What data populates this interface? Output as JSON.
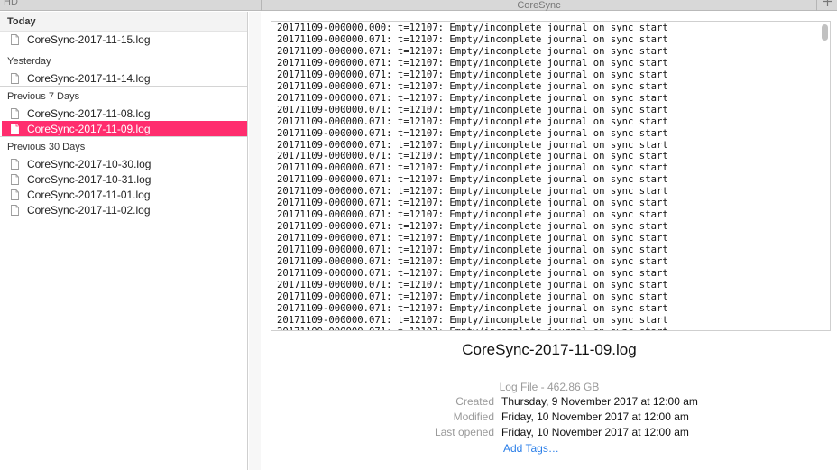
{
  "tabbar": {
    "left_label": "HD",
    "title": "CoreSync"
  },
  "sidebar": {
    "sections": [
      {
        "header": "Today",
        "files": [
          "CoreSync-2017-11-15.log"
        ]
      },
      {
        "header": "Yesterday",
        "files": [
          "CoreSync-2017-11-14.log"
        ]
      },
      {
        "header": "Previous 7 Days",
        "files": [
          "CoreSync-2017-11-08.log",
          "CoreSync-2017-11-09.log"
        ]
      },
      {
        "header": "Previous 30 Days",
        "files": [
          "CoreSync-2017-10-30.log",
          "CoreSync-2017-10-31.log",
          "CoreSync-2017-11-01.log",
          "CoreSync-2017-11-02.log"
        ]
      }
    ],
    "selected_file": "CoreSync-2017-11-09.log"
  },
  "preview": {
    "first_line": "20171109-000000.000: t=12107: Empty/incomplete journal on sync start",
    "repeated_line": "20171109-000000.071: t=12107: Empty/incomplete journal on sync start"
  },
  "details": {
    "file_name": "CoreSync-2017-11-09.log",
    "type_size": "Log File - 462.86 GB",
    "created_label": "Created",
    "created_value": "Thursday, 9 November 2017 at 12:00 am",
    "modified_label": "Modified",
    "modified_value": "Friday, 10 November 2017 at 12:00 am",
    "last_opened_label": "Last opened",
    "last_opened_value": "Friday, 10 November 2017 at 12:00 am",
    "add_tags": "Add Tags…"
  }
}
